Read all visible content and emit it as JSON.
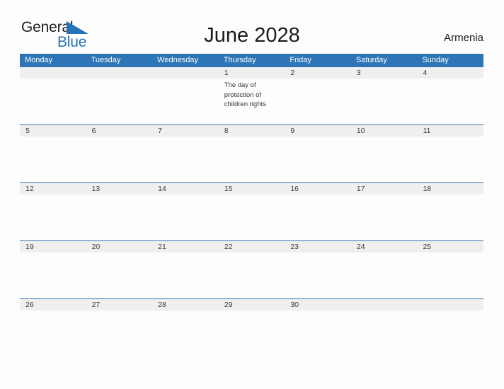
{
  "brand": {
    "name_part1": "General",
    "name_part2": "Blue",
    "flag_icon": "blue-triangle-flag-icon",
    "color_dark": "#231f20",
    "color_blue": "#2572b8"
  },
  "header": {
    "title": "June 2028",
    "country": "Armenia"
  },
  "theme": {
    "header_blue": "#2e75b6",
    "date_band_gray": "#efefef",
    "page_background": "#fdfdfd",
    "rule_blue": "#2e75b6"
  },
  "calendar": {
    "month": "June",
    "year": "2028",
    "weekday_headers": [
      "Monday",
      "Tuesday",
      "Wednesday",
      "Thursday",
      "Friday",
      "Saturday",
      "Sunday"
    ],
    "weeks": [
      {
        "days": [
          {
            "date": "",
            "events": []
          },
          {
            "date": "",
            "events": []
          },
          {
            "date": "",
            "events": []
          },
          {
            "date": "1",
            "events": [
              "The day of protection of children rights"
            ]
          },
          {
            "date": "2",
            "events": []
          },
          {
            "date": "3",
            "events": []
          },
          {
            "date": "4",
            "events": []
          }
        ]
      },
      {
        "days": [
          {
            "date": "5",
            "events": []
          },
          {
            "date": "6",
            "events": []
          },
          {
            "date": "7",
            "events": []
          },
          {
            "date": "8",
            "events": []
          },
          {
            "date": "9",
            "events": []
          },
          {
            "date": "10",
            "events": []
          },
          {
            "date": "11",
            "events": []
          }
        ]
      },
      {
        "days": [
          {
            "date": "12",
            "events": []
          },
          {
            "date": "13",
            "events": []
          },
          {
            "date": "14",
            "events": []
          },
          {
            "date": "15",
            "events": []
          },
          {
            "date": "16",
            "events": []
          },
          {
            "date": "17",
            "events": []
          },
          {
            "date": "18",
            "events": []
          }
        ]
      },
      {
        "days": [
          {
            "date": "19",
            "events": []
          },
          {
            "date": "20",
            "events": []
          },
          {
            "date": "21",
            "events": []
          },
          {
            "date": "22",
            "events": []
          },
          {
            "date": "23",
            "events": []
          },
          {
            "date": "24",
            "events": []
          },
          {
            "date": "25",
            "events": []
          }
        ]
      },
      {
        "days": [
          {
            "date": "26",
            "events": []
          },
          {
            "date": "27",
            "events": []
          },
          {
            "date": "28",
            "events": []
          },
          {
            "date": "29",
            "events": []
          },
          {
            "date": "30",
            "events": []
          },
          {
            "date": "",
            "events": []
          },
          {
            "date": "",
            "events": []
          }
        ]
      }
    ]
  }
}
